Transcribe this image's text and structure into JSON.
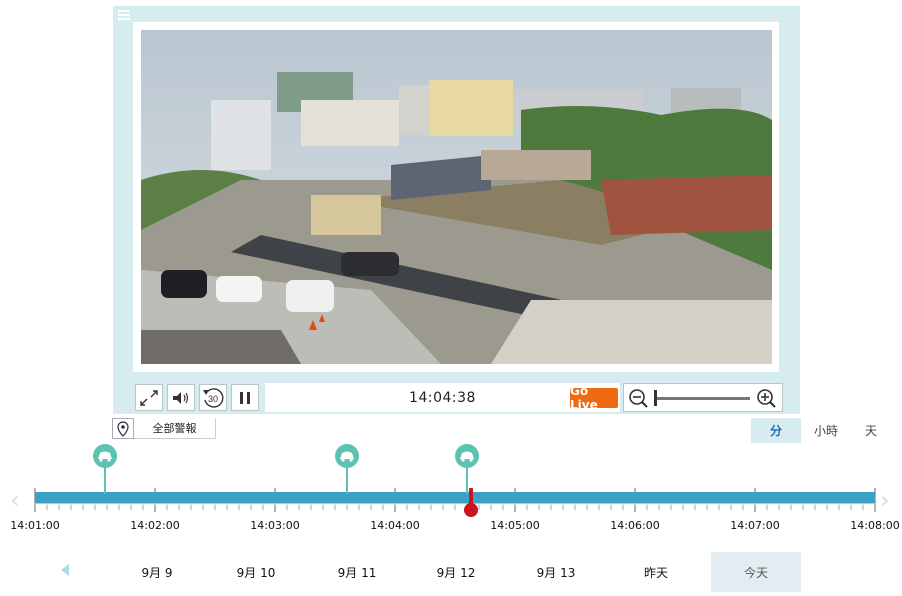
{
  "player": {
    "time": "14:04:38",
    "go_live_label": "Go Live",
    "rewind_seconds": "30",
    "zoom_level": 0.0
  },
  "filter": {
    "events_label": "全部警報"
  },
  "scale": {
    "options": [
      "分",
      "小時",
      "天"
    ],
    "selected": "分"
  },
  "timeline": {
    "ticks": [
      "14:01:00",
      "14:02:00",
      "14:03:00",
      "14:04:00",
      "14:05:00",
      "14:06:00",
      "14:07:00",
      "14:08:00"
    ],
    "events": [
      {
        "type": "vehicle",
        "time": "14:01:35"
      },
      {
        "type": "vehicle",
        "time": "14:03:36"
      },
      {
        "type": "vehicle",
        "time": "14:04:36"
      }
    ],
    "playhead_time": "14:04:38",
    "colors": {
      "bar": "#3ba0c6",
      "marker": "#5cc3b2",
      "playhead": "#c8161d"
    }
  },
  "dates": {
    "items": [
      "9月 9",
      "9月 10",
      "9月 11",
      "9月 12",
      "9月 13",
      "昨天",
      "今天"
    ],
    "selected": "今天"
  }
}
